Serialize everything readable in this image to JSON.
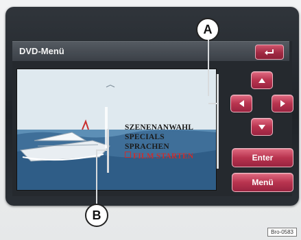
{
  "window": {
    "title": "DVD-Menü"
  },
  "dvd_menu": {
    "items": [
      {
        "label": "SZENENANWAHL",
        "selected": false
      },
      {
        "label": "SPECIALS",
        "selected": false
      },
      {
        "label": "SPRACHEN",
        "selected": false
      },
      {
        "label": "FILM STARTEN",
        "selected": true
      }
    ]
  },
  "controls": {
    "up_icon": "arrow-up-icon",
    "down_icon": "arrow-down-icon",
    "left_icon": "arrow-left-icon",
    "right_icon": "arrow-right-icon",
    "back_icon": "return-arrow-icon",
    "enter_label": "Enter",
    "menu_label": "Menü"
  },
  "callouts": {
    "a": "A",
    "b": "B"
  },
  "footer": {
    "ref_code": "Bro-0583"
  },
  "colors": {
    "button_accent": "#b8344f",
    "screen_frame": "#25292e",
    "selected_item": "#c92e2e"
  }
}
